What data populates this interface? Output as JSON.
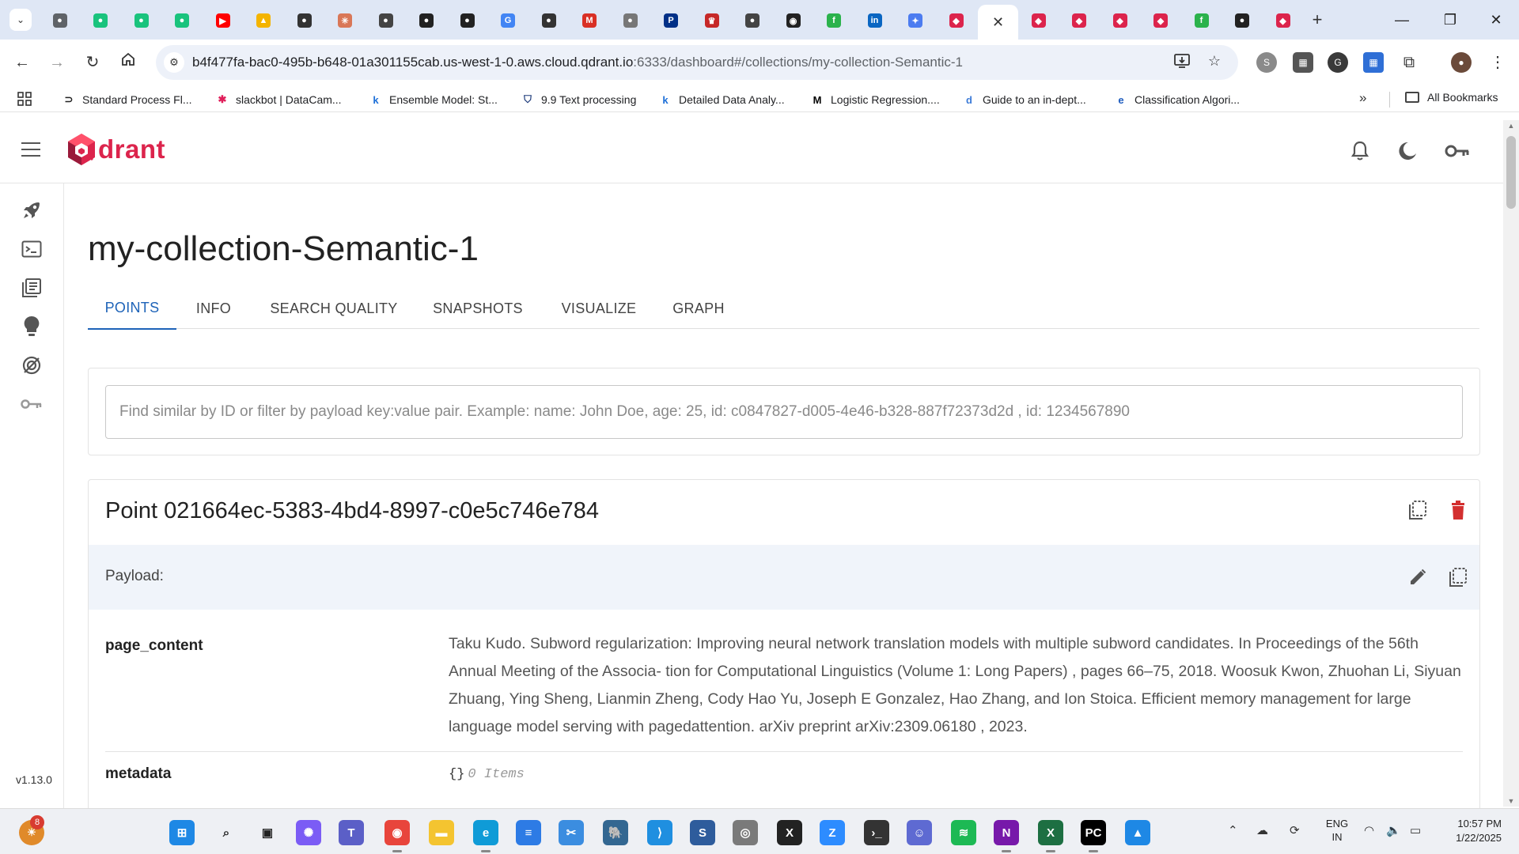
{
  "browser": {
    "tab_count_icons": [
      "profile",
      "chatgpt",
      "chatgpt",
      "chatgpt",
      "youtube",
      "drive",
      "chatgpt-circle",
      "claude",
      "openai",
      "chatgpt-dark",
      "chatgpt-dark",
      "google",
      "chatgpt-circle",
      "gmail",
      "chrome-gray",
      "paypal",
      "crown",
      "openai",
      "github",
      "feedly",
      "linkedin",
      "gemini",
      "qdrant"
    ],
    "active_tab_close": "✕",
    "url": "b4f477fa-bac0-495b-b648-01a301155cab.us-west-1-0.aws.cloud.qdrant.io",
    "url_path": ":6333/dashboard#/collections/my-collection-Semantic-1",
    "new_tab": "+",
    "window_controls": {
      "minimize": "—",
      "maximize": "❐",
      "close": "✕"
    }
  },
  "bookmarks": {
    "items": [
      {
        "label": "Standard Process Fl...",
        "icon": "process-icon",
        "color": "#222"
      },
      {
        "label": "slackbot | DataCam...",
        "icon": "slack-icon",
        "color": "#e01e5a"
      },
      {
        "label": "Ensemble Model: St...",
        "icon": "k-icon",
        "color": "#1d6fd8"
      },
      {
        "label": "9.9 Text processing",
        "icon": "shield-icon",
        "color": "#1c3a7a"
      },
      {
        "label": "Detailed Data Analy...",
        "icon": "k-icon",
        "color": "#1d6fd8"
      },
      {
        "label": "Logistic Regression....",
        "icon": "medium-icon",
        "color": "#000"
      },
      {
        "label": "Guide to an in-dept...",
        "icon": "d-icon",
        "color": "#3c7bd8"
      },
      {
        "label": "Classification Algori...",
        "icon": "e-icon",
        "color": "#1e5cbf"
      }
    ],
    "more": "»",
    "all_bookmarks": "All Bookmarks"
  },
  "app": {
    "logo_text": "drant",
    "version": "v1.13.0",
    "collection_title": "my-collection-Semantic-1",
    "tabs": [
      "POINTS",
      "INFO",
      "SEARCH QUALITY",
      "SNAPSHOTS",
      "VISUALIZE",
      "GRAPH"
    ],
    "active_tab": "POINTS",
    "search": {
      "placeholder": "Find similar by ID or filter by payload key:value pair. Example: name: John Doe, age: 25, id: c0847827-d005-4e46-b328-887f72373d2d , id: 1234567890",
      "value": ""
    },
    "point": {
      "title": "Point 021664ec-5383-4bd4-8997-c0e5c746e784",
      "payload_label": "Payload:",
      "fields": [
        {
          "key": "page_content",
          "value": "Taku Kudo. Subword regularization: Improving neural network translation models with multiple subword candidates. In Proceedings of the 56th Annual Meeting of the Associa- tion for Computational Linguistics (Volume 1: Long Papers) , pages 66–75, 2018. Woosuk Kwon, Zhuohan Li, Siyuan Zhuang, Ying Sheng, Lianmin Zheng, Cody Hao Yu, Joseph E Gonzalez, Hao Zhang, and Ion Stoica. Efficient memory management for large language model serving with pagedattention. arXiv preprint arXiv:2309.06180 , 2023."
        },
        {
          "key": "metadata",
          "braces": "{}",
          "items": "0 Items"
        }
      ]
    },
    "colors": {
      "brand": "#dc244c",
      "accent": "#1e63b8",
      "delete": "#d32f2f",
      "payload_bg": "#f0f4fa"
    }
  },
  "taskbar": {
    "badge": "8",
    "lang_line1": "ENG",
    "lang_line2": "IN",
    "time": "10:57 PM",
    "date": "1/22/2025"
  }
}
